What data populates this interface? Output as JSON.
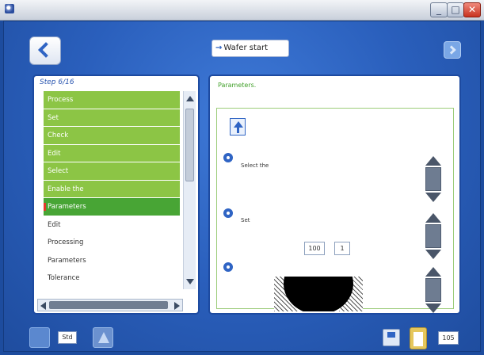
{
  "header": {
    "step_title_arrow": "→",
    "step_title": "Wafer start"
  },
  "left_panel": {
    "step_counter": "Step 6/16",
    "steps": [
      {
        "label": "Process",
        "state": "done"
      },
      {
        "label": "Set",
        "state": "done"
      },
      {
        "label": "Check",
        "state": "done"
      },
      {
        "label": "Edit",
        "state": "done"
      },
      {
        "label": "Select",
        "state": "done"
      },
      {
        "label": "Enable the",
        "state": "done"
      },
      {
        "label": "Parameters",
        "state": "current"
      },
      {
        "label": "Edit",
        "state": "pending"
      },
      {
        "label": "Processing",
        "state": "pending"
      },
      {
        "label": "Parameters",
        "state": "pending"
      },
      {
        "label": "Tolerance",
        "state": "pending"
      }
    ]
  },
  "right_panel": {
    "instruction": "Parameters.",
    "para1": "Select the",
    "para2": "Set",
    "field_a": "100",
    "field_b": "1"
  },
  "toolbar": {
    "label": "Std",
    "number": "105"
  },
  "colors": {
    "frame_blue": "#2a5fbc",
    "step_done_green": "#8cc545",
    "step_current_green": "#48a535",
    "instruction_green": "#41a02a"
  }
}
